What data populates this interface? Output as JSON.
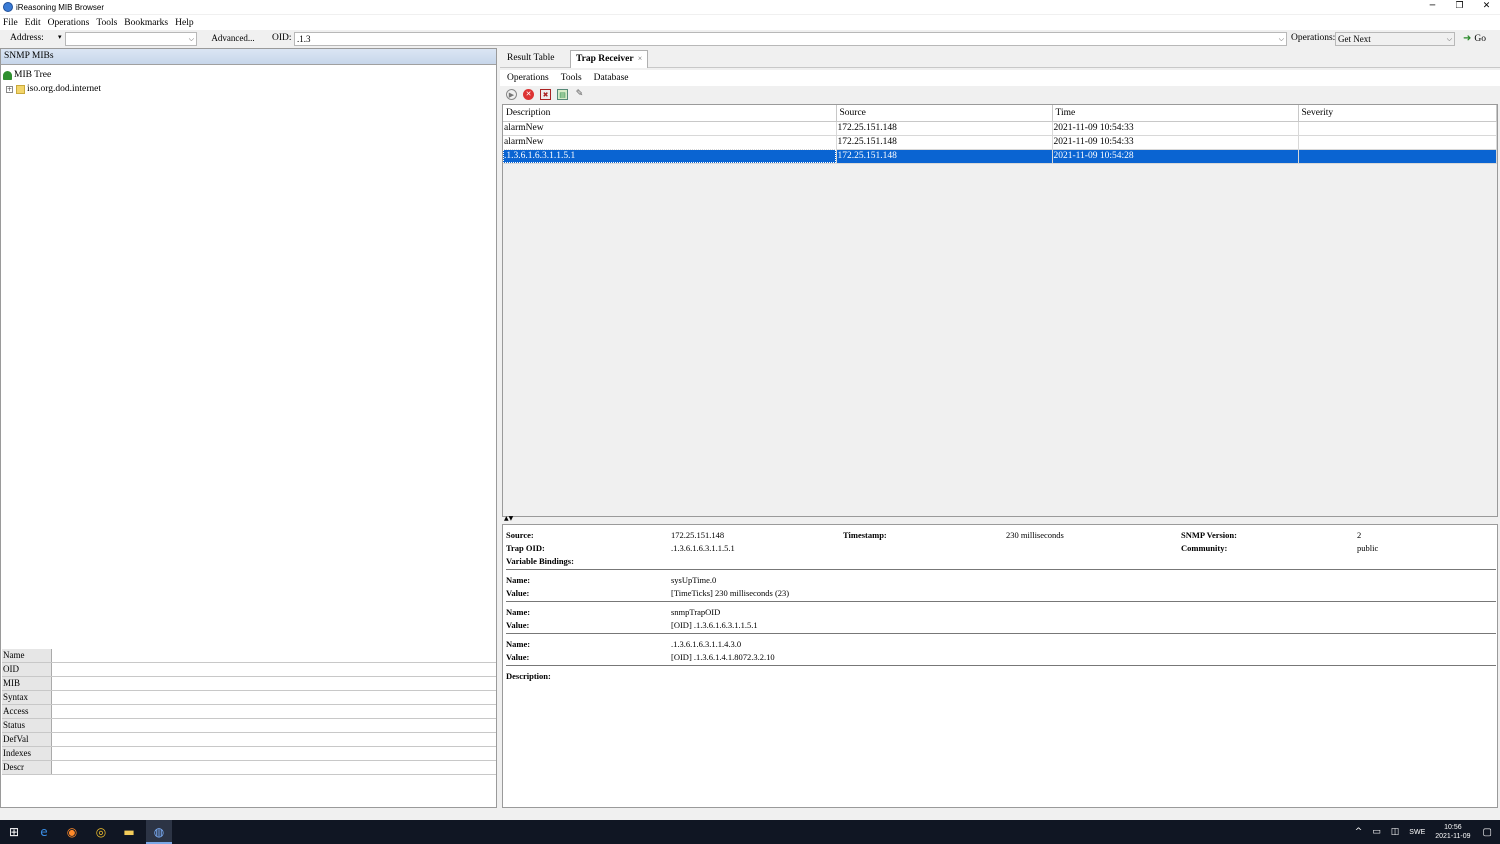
{
  "window": {
    "title": "iReasoning MIB Browser",
    "minimize": "─",
    "restore": "❐",
    "close": "✕"
  },
  "menu": [
    "File",
    "Edit",
    "Operations",
    "Tools",
    "Bookmarks",
    "Help"
  ],
  "toolbar": {
    "address_label": "Address:",
    "address_value": "",
    "advanced_label": "Advanced...",
    "oid_label": "OID:",
    "oid_value": ".1.3",
    "operations_label": "Operations:",
    "operations_value": "Get Next",
    "go_label": "Go"
  },
  "left": {
    "header": "SNMP MIBs",
    "tree": [
      {
        "label": "MIB Tree"
      },
      {
        "label": "iso.org.dod.internet"
      }
    ],
    "props": [
      "Name",
      "OID",
      "MIB",
      "Syntax",
      "Access",
      "Status",
      "DefVal",
      "Indexes",
      "Descr"
    ]
  },
  "tabs": [
    {
      "label": "Result Table"
    },
    {
      "label": "Trap Receiver",
      "close": "×"
    }
  ],
  "trap_menu": [
    "Operations",
    "Tools",
    "Database"
  ],
  "trap_table": {
    "columns": [
      "Description",
      "Source",
      "Time",
      "Severity"
    ],
    "rows": [
      [
        "alarmNew",
        "172.25.151.148",
        "2021-11-09 10:54:33",
        ""
      ],
      [
        "alarmNew",
        "172.25.151.148",
        "2021-11-09 10:54:33",
        ""
      ],
      [
        ".1.3.6.1.6.3.1.1.5.1",
        "172.25.151.148",
        "2021-11-09 10:54:28",
        ""
      ]
    ],
    "selected_row": 2
  },
  "details": {
    "source_label": "Source:",
    "source_value": "172.25.151.148",
    "timestamp_label": "Timestamp:",
    "timestamp_value": "230 milliseconds",
    "snmp_version_label": "SNMP Version:",
    "snmp_version_value": "2",
    "trap_oid_label": "Trap OID:",
    "trap_oid_value": ".1.3.6.1.6.3.1.1.5.1",
    "community_label": "Community:",
    "community_value": "public",
    "varbinds_label": "Variable Bindings:",
    "bindings": [
      {
        "name_label": "Name:",
        "name": "sysUpTime.0",
        "value_label": "Value:",
        "value": "[TimeTicks] 230 milliseconds (23)"
      },
      {
        "name_label": "Name:",
        "name": "snmpTrapOID",
        "value_label": "Value:",
        "value": "[OID] .1.3.6.1.6.3.1.1.5.1"
      },
      {
        "name_label": "Name:",
        "name": ".1.3.6.1.6.3.1.1.4.3.0",
        "value_label": "Value:",
        "value": "[OID] .1.3.6.1.4.1.8072.3.2.10"
      }
    ],
    "description_label": "Description:"
  },
  "taskbar": {
    "lang": "SWE",
    "time": "10:56",
    "date": "2021-11-09"
  }
}
